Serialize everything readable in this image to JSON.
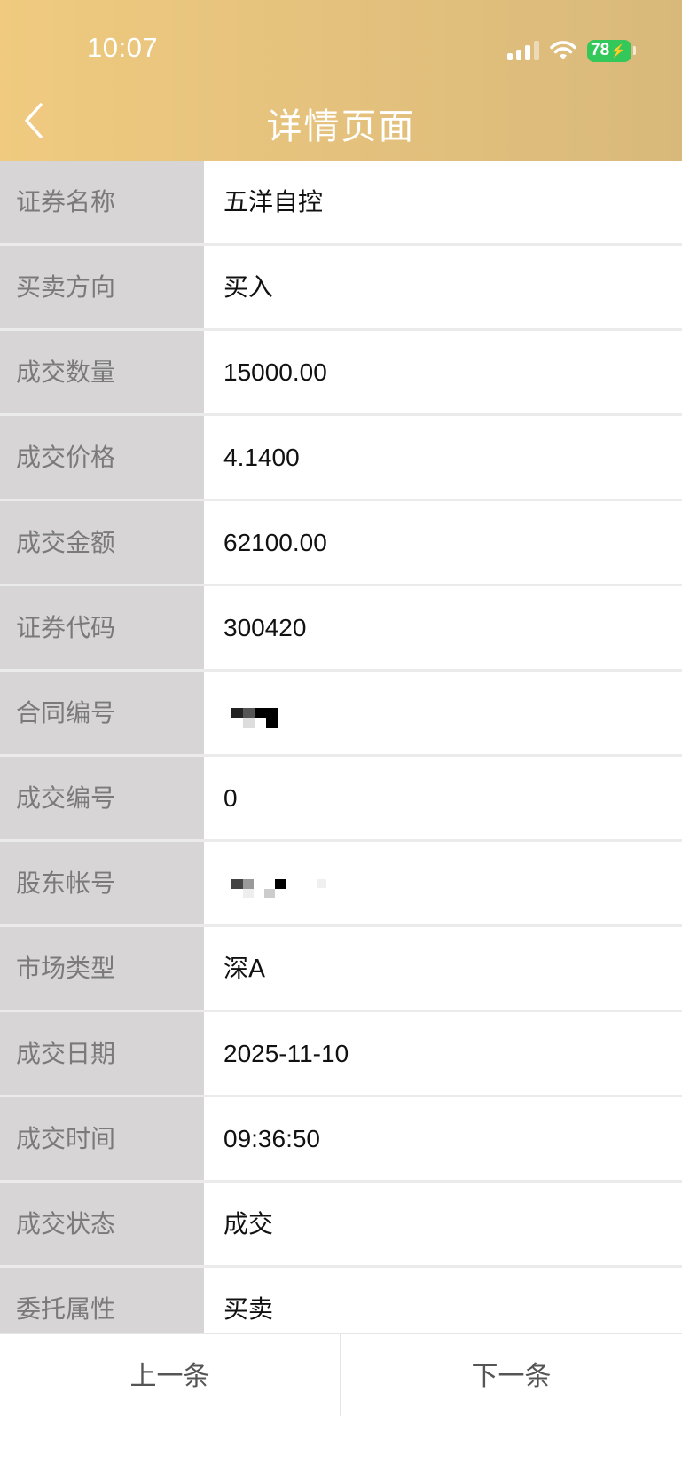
{
  "status_bar": {
    "time": "10:07",
    "battery": "78",
    "icons": [
      "signal-icon",
      "wifi-icon",
      "battery-icon"
    ]
  },
  "header": {
    "title": "详情页面",
    "back_icon": "chevron-left-icon",
    "gradient_start": "#efca7f",
    "gradient_end": "#d9b97b"
  },
  "details": [
    {
      "label": "证券名称",
      "value": "五洋自控"
    },
    {
      "label": "买卖方向",
      "value": "买入"
    },
    {
      "label": "成交数量",
      "value": "15000.00"
    },
    {
      "label": "成交价格",
      "value": "4.1400"
    },
    {
      "label": "成交金额",
      "value": "62100.00"
    },
    {
      "label": "证券代码",
      "value": "300420"
    },
    {
      "label": "合同编号",
      "value": ""
    },
    {
      "label": "成交编号",
      "value": "0"
    },
    {
      "label": "股东帐号",
      "value": ""
    },
    {
      "label": "市场类型",
      "value": "深A"
    },
    {
      "label": "成交日期",
      "value": "2025-11-10"
    },
    {
      "label": "成交时间",
      "value": "09:36:50"
    },
    {
      "label": "成交状态",
      "value": "成交"
    },
    {
      "label": "委托属性",
      "value": "买卖"
    }
  ],
  "footer": {
    "prev_label": "上一条",
    "next_label": "下一条"
  }
}
